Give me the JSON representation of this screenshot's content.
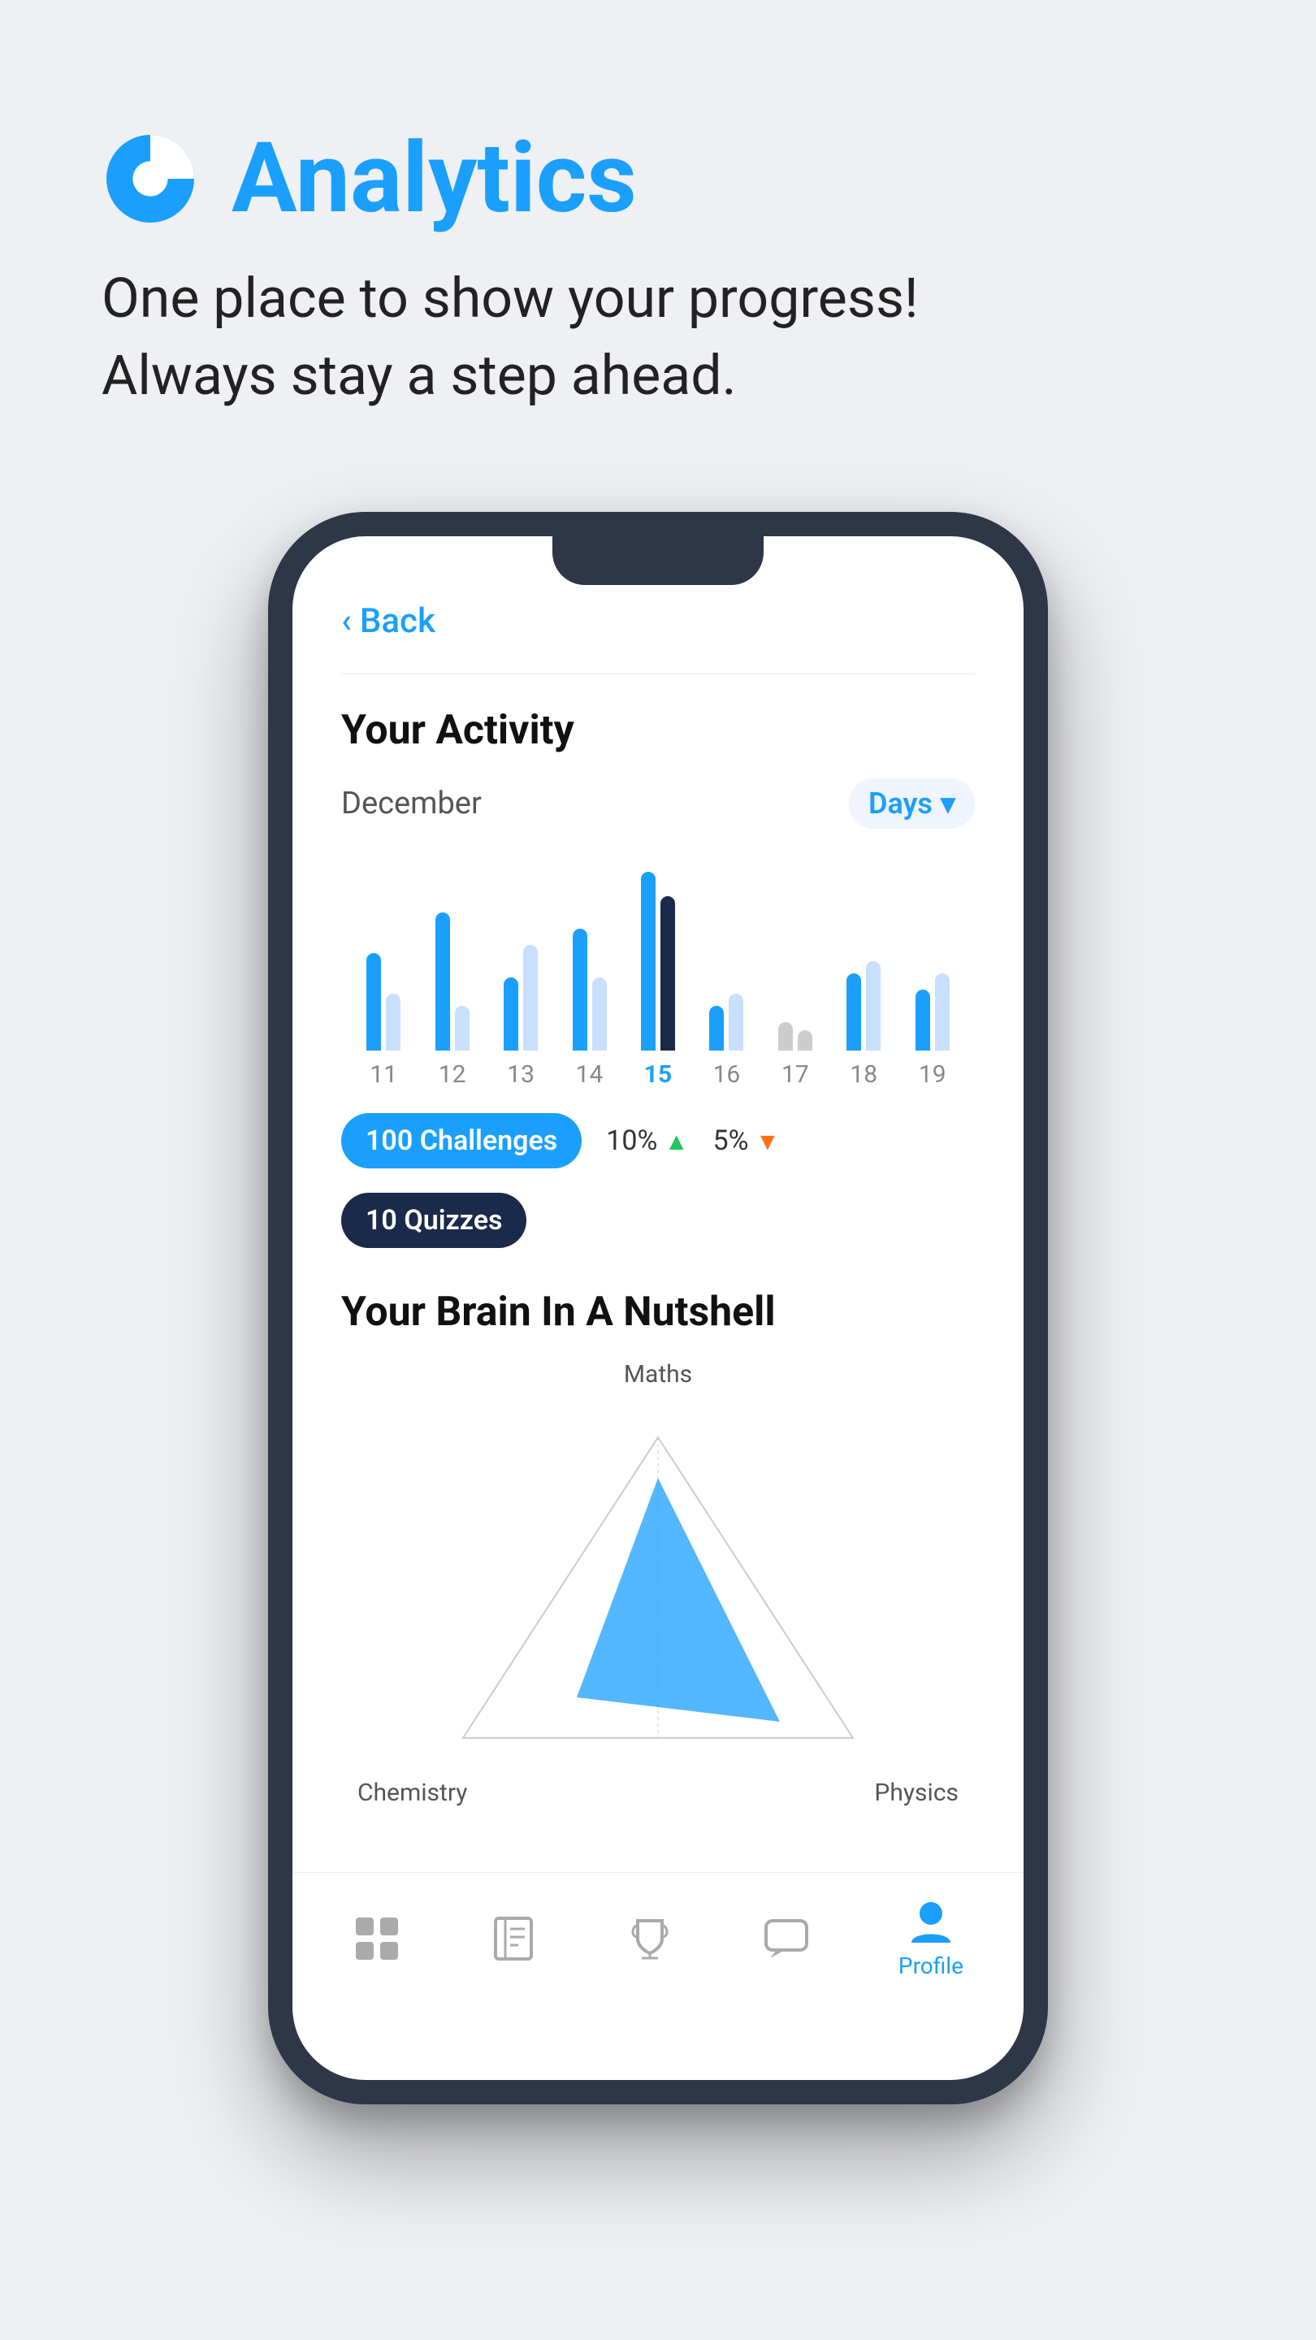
{
  "header": {
    "title": "Analytics",
    "subtitle_line1": "One place to show your progress!",
    "subtitle_line2": "Always stay a step ahead.",
    "icon_label": "analytics-pie-icon"
  },
  "phone": {
    "back_label": "Back",
    "screen": {
      "activity": {
        "title": "Your Activity",
        "month": "December",
        "period_selector": "Days",
        "bars": [
          {
            "day": "11",
            "heights": [
              120,
              80
            ],
            "selected": false
          },
          {
            "day": "12",
            "heights": [
              180,
              60
            ],
            "selected": false
          },
          {
            "day": "13",
            "heights": [
              100,
              140
            ],
            "selected": false
          },
          {
            "day": "14",
            "heights": [
              160,
              100
            ],
            "selected": false
          },
          {
            "day": "15",
            "heights": [
              220,
              200
            ],
            "selected": true
          },
          {
            "day": "16",
            "heights": [
              60,
              80
            ],
            "selected": false
          },
          {
            "day": "17",
            "heights": [
              40,
              30
            ],
            "selected": false
          },
          {
            "day": "18",
            "heights": [
              100,
              120
            ],
            "selected": false
          },
          {
            "day": "19",
            "heights": [
              80,
              100
            ],
            "selected": false
          }
        ],
        "stats": [
          {
            "type": "badge_blue",
            "value": "100",
            "label": "Challenges"
          },
          {
            "type": "percent_up",
            "value": "10%",
            "direction": "up"
          },
          {
            "type": "percent_down",
            "value": "5%",
            "direction": "down"
          },
          {
            "type": "badge_dark",
            "value": "10",
            "label": "Quizzes"
          }
        ]
      },
      "brain": {
        "title": "Your Brain In A Nutshell",
        "labels": {
          "top": "Maths",
          "bottom_left": "Chemistry",
          "bottom_right": "Physics"
        }
      }
    },
    "nav": [
      {
        "icon": "grid-icon",
        "label": "",
        "active": false
      },
      {
        "icon": "book-icon",
        "label": "",
        "active": false
      },
      {
        "icon": "trophy-icon",
        "label": "",
        "active": false
      },
      {
        "icon": "chat-icon",
        "label": "",
        "active": false
      },
      {
        "icon": "profile-icon",
        "label": "Profile",
        "active": true
      }
    ]
  }
}
